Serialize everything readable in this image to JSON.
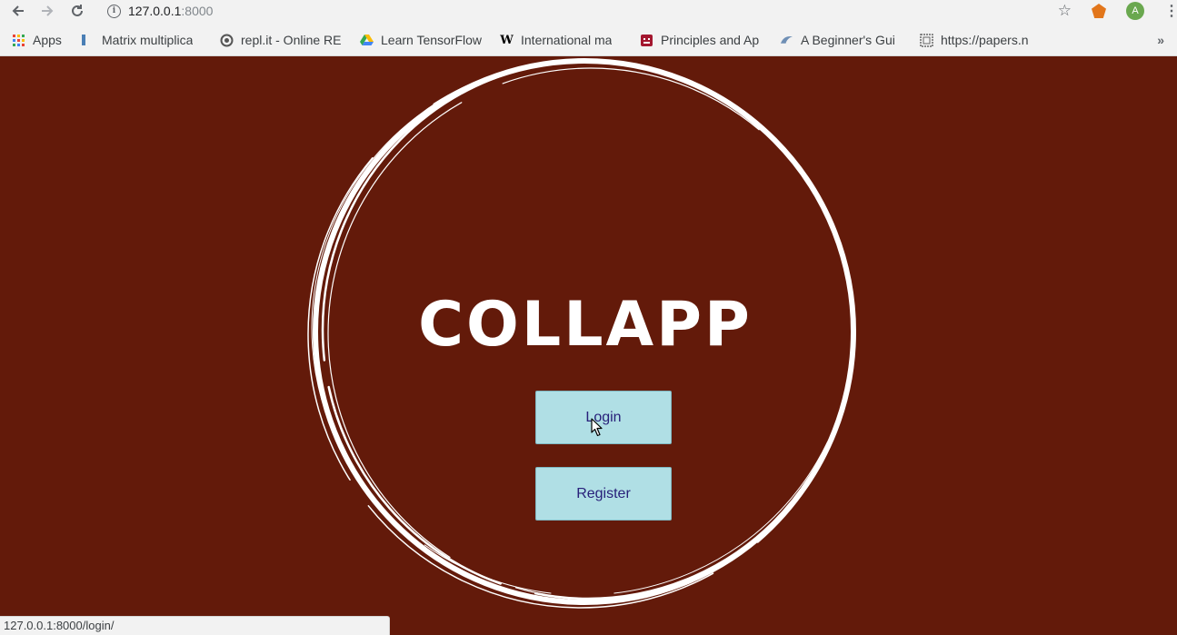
{
  "browser": {
    "url_host": "127.0.0.1",
    "url_port": ":8000",
    "avatar_letter": "A",
    "bookmarks": [
      {
        "label": "Apps",
        "icon": "apps-grid-icon"
      },
      {
        "label": "Matrix multiplica",
        "icon": "matrix-icon"
      },
      {
        "label": "repl.it - Online RE",
        "icon": "replit-icon"
      },
      {
        "label": "Learn TensorFlow",
        "icon": "google-drive-icon"
      },
      {
        "label": "International ma",
        "icon": "wikipedia-icon"
      },
      {
        "label": "Principles and Ap",
        "icon": "book-icon"
      },
      {
        "label": "A Beginner's Gui",
        "icon": "guide-icon"
      },
      {
        "label": "https://papers.n",
        "icon": "page-icon"
      }
    ],
    "overflow_label": "»"
  },
  "page": {
    "logo_text": "COLLAPP",
    "login_label": "Login",
    "register_label": "Register",
    "background_color": "#631a0a",
    "button_color": "#b0dfe5"
  },
  "status_bar": {
    "text": "127.0.0.1:8000/login/"
  }
}
